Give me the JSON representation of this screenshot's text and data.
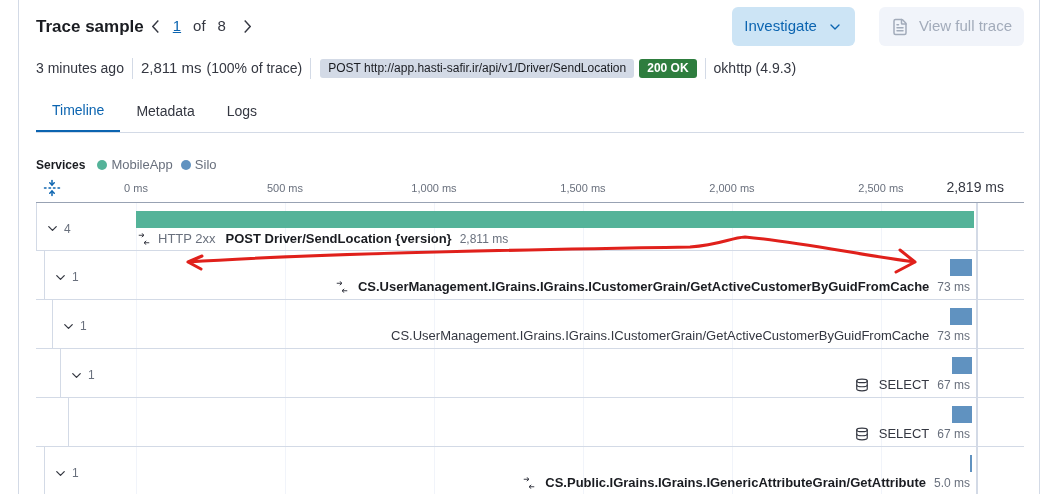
{
  "header": {
    "title": "Trace sample",
    "pager": {
      "current": "1",
      "of": "of",
      "total": "8"
    },
    "buttons": [
      {
        "label": "Investigate",
        "kind": "menu",
        "disabled": false
      },
      {
        "label": "View full trace",
        "kind": "doc",
        "disabled": true
      }
    ]
  },
  "meta": {
    "age": "3 minutes ago",
    "duration": "2,811 ms",
    "share": "(100% of trace)",
    "request": "POST http://app.hasti-safir.ir/api/v1/Driver/SendLocation",
    "status": "200 OK",
    "agent": "okhttp (4.9.3)"
  },
  "tabs": [
    {
      "label": "Timeline",
      "selected": true
    },
    {
      "label": "Metadata",
      "selected": false
    },
    {
      "label": "Logs",
      "selected": false
    }
  ],
  "services": {
    "label": "Services",
    "items": [
      {
        "name": "MobileApp",
        "color": "#54b399"
      },
      {
        "name": "Silo",
        "color": "#6092c0"
      }
    ]
  },
  "axis": {
    "ticks": [
      "0 ms",
      "500 ms",
      "1,000 ms",
      "1,500 ms",
      "2,000 ms",
      "2,500 ms"
    ],
    "total": "2,819 ms"
  },
  "spans": [
    {
      "count": "4",
      "expanded": true,
      "color": "#54b399",
      "kind": "exit",
      "badge": "HTTP 2xx",
      "name": "POST Driver/SendLocation {version}",
      "bold": true,
      "duration": "2,811 ms",
      "children": [
        {
          "count": "1",
          "expanded": true,
          "color": "#6092c0",
          "kind": "exit",
          "name": "CS.UserManagement.IGrains.IGrains.ICustomerGrain/GetActiveCustomerByGuidFromCache",
          "bold": true,
          "duration": "73 ms",
          "children": [
            {
              "count": "1",
              "expanded": true,
              "color": "#6092c0",
              "name": "CS.UserManagement.IGrains.IGrains.ICustomerGrain/GetActiveCustomerByGuidFromCache",
              "bold": false,
              "duration": "73 ms",
              "children": [
                {
                  "count": "1",
                  "expanded": true,
                  "color": "#6092c0",
                  "kind": "db",
                  "name": "SELECT",
                  "bold": false,
                  "duration": "67 ms",
                  "children": [
                    {
                      "color": "#6092c0",
                      "kind": "db",
                      "name": "SELECT",
                      "bold": false,
                      "duration": "67 ms"
                    }
                  ]
                }
              ]
            }
          ]
        },
        {
          "count": "1",
          "expanded": true,
          "color": "#6092c0",
          "kind": "exit",
          "name": "CS.Public.IGrains.IGrains.IGenericAttributeGrain/GetAttribute",
          "bold": true,
          "duration": "5.0 ms"
        }
      ]
    }
  ]
}
